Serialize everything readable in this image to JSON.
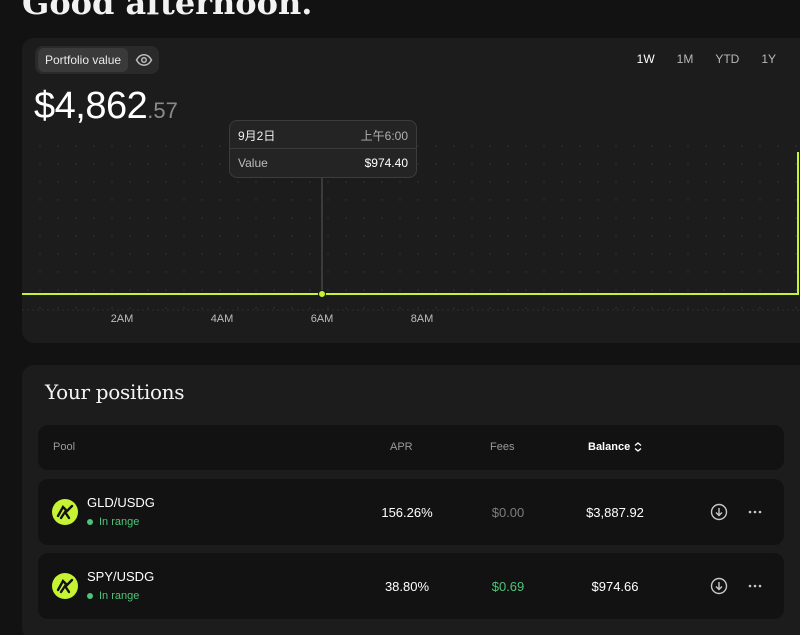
{
  "greeting": "Good afternoon.",
  "portfolio": {
    "label": "Portfolio value",
    "amount_main": "$4,862",
    "amount_cents": ".57",
    "visibility_icon": "eye-icon"
  },
  "timeframes": [
    "1W",
    "1M",
    "YTD",
    "1Y"
  ],
  "tooltip": {
    "date": "9月2日",
    "time": "上午6:00",
    "value_label": "Value",
    "value": "$974.40"
  },
  "chart_data": {
    "type": "line",
    "x": [
      "2AM",
      "4AM",
      "6AM",
      "8AM"
    ],
    "series": [
      {
        "values": [
          974.4,
          974.4,
          974.4,
          974.4
        ]
      }
    ],
    "title": "",
    "xlabel": "",
    "ylabel": "",
    "line_color": "#c6f432",
    "grid": "dotted",
    "highlighted_point": {
      "x": "6AM",
      "y": 974.4
    }
  },
  "positions": {
    "title": "Your positions",
    "columns": {
      "pool": "Pool",
      "apr": "APR",
      "fees": "Fees",
      "balance": "Balance"
    },
    "rows": [
      {
        "pool": "GLD/USDG",
        "status": "In range",
        "apr": "156.26%",
        "fees": "$0.00",
        "balance": "$3,887.92"
      },
      {
        "pool": "SPY/USDG",
        "status": "In range",
        "apr": "38.80%",
        "fees": "$0.69",
        "balance": "$974.66"
      }
    ]
  },
  "colors": {
    "accent": "#c6f432",
    "in_range": "#4ec47a",
    "background": "#121212",
    "card": "#1c1c1c"
  }
}
